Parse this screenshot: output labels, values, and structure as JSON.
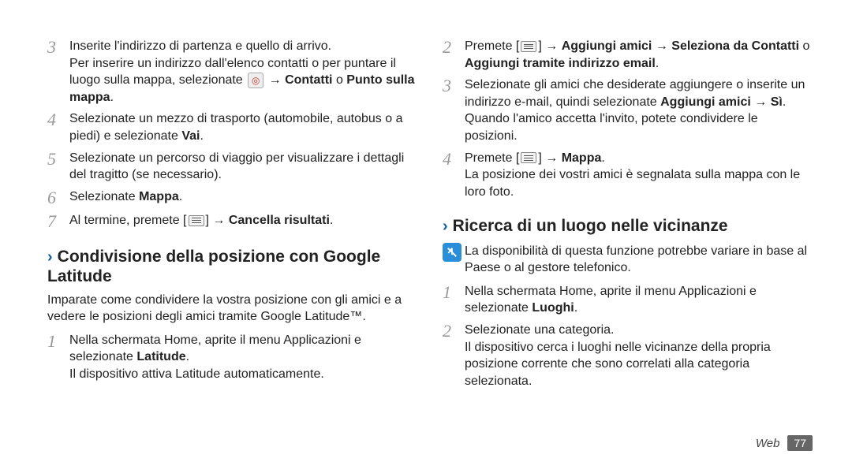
{
  "left": {
    "steps_a": [
      {
        "num": "3",
        "line1": "Inserite l'indirizzo di partenza e quello di arrivo.",
        "line2_pre": "Per inserire un indirizzo dall'elenco contatti o per puntare il luogo sulla mappa, selezionate ",
        "line2_post_arrow": " → ",
        "line2_bold1": "Contatti",
        "line2_or": " o ",
        "line2_bold2": "Punto sulla mappa",
        "line2_end": "."
      },
      {
        "num": "4",
        "line1_pre": "Selezionate un mezzo di trasporto (automobile, autobus o a piedi) e selezionate ",
        "line1_bold": "Vai",
        "line1_end": "."
      },
      {
        "num": "5",
        "line1": "Selezionate un percorso di viaggio per visualizzare i dettagli del tragitto (se necessario)."
      },
      {
        "num": "6",
        "line1_pre": "Selezionate ",
        "line1_bold": "Mappa",
        "line1_end": "."
      },
      {
        "num": "7",
        "line1_pre": "Al termine, premete [",
        "line1_post": "] → ",
        "line1_bold": "Cancella risultati",
        "line1_end": "."
      }
    ],
    "section_title": "Condivisione della posizione con Google Latitude",
    "intro": "Imparate come condividere la vostra posizione con gli amici e a vedere le posizioni degli amici tramite Google Latitude™.",
    "steps_b": [
      {
        "num": "1",
        "line1_pre": "Nella schermata Home, aprite il menu Applicazioni e selezionate ",
        "line1_bold": "Latitude",
        "line1_end": ".",
        "line2": "Il dispositivo attiva Latitude automaticamente."
      }
    ]
  },
  "right": {
    "steps_a": [
      {
        "num": "2",
        "line1_pre": "Premete [",
        "line1_post": "] → ",
        "line1_bold1": "Aggiungi amici",
        "line1_arrow": " → ",
        "line1_bold2": "Seleziona da Contatti",
        "line1_or": " o ",
        "line1_bold3": "Aggiungi tramite indirizzo email",
        "line1_end": "."
      },
      {
        "num": "3",
        "line1_pre": "Selezionate gli amici che desiderate aggiungere o inserite un indirizzo e-mail, quindi selezionate ",
        "line1_bold1": "Aggiungi amici",
        "line1_arrow": " → ",
        "line1_bold2": "Sì",
        "line1_end": ".",
        "line2": "Quando l'amico accetta l'invito, potete condividere le posizioni."
      },
      {
        "num": "4",
        "line1_pre": "Premete [",
        "line1_post": "] → ",
        "line1_bold": "Mappa",
        "line1_end": ".",
        "line2": "La posizione dei vostri amici è segnalata sulla mappa con le loro foto."
      }
    ],
    "section_title": "Ricerca di un luogo nelle vicinanze",
    "note": "La disponibilità di questa funzione potrebbe variare in base al Paese o al gestore telefonico.",
    "steps_b": [
      {
        "num": "1",
        "line1_pre": "Nella schermata Home, aprite il menu Applicazioni e selezionate ",
        "line1_bold": "Luoghi",
        "line1_end": "."
      },
      {
        "num": "2",
        "line1": "Selezionate una categoria.",
        "line2": "Il dispositivo cerca i luoghi nelle vicinanze della propria posizione corrente che sono correlati alla categoria selezionata."
      }
    ]
  },
  "footer": {
    "section": "Web",
    "page": "77"
  }
}
